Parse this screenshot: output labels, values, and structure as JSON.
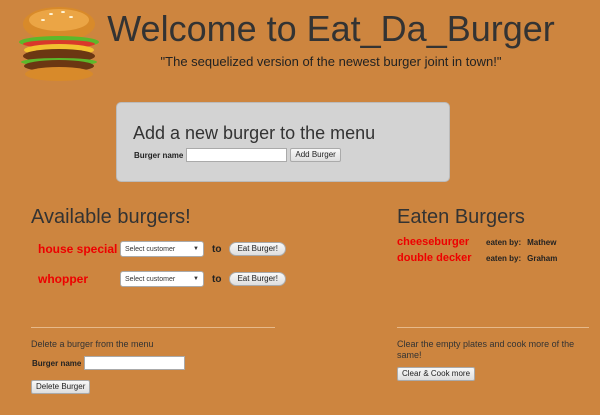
{
  "header": {
    "title": "Welcome to Eat_Da_Burger",
    "tagline": "\"The sequelized version of the newest burger joint in town!\"",
    "logo_icon": "burger-logo-icon"
  },
  "add_panel": {
    "heading": "Add a new burger to the menu",
    "label": "Burger name",
    "input_value": "",
    "button_label": "Add Burger"
  },
  "available": {
    "heading": "Available burgers!",
    "items": [
      {
        "name": "house special",
        "select_value": "Select customer",
        "to_label": "to",
        "button_label": "Eat Burger!"
      },
      {
        "name": "whopper",
        "select_value": "Select customer",
        "to_label": "to",
        "button_label": "Eat Burger!"
      }
    ]
  },
  "eaten": {
    "heading": "Eaten Burgers",
    "items": [
      {
        "name": "cheeseburger",
        "label": "eaten by:",
        "eater": "Mathew"
      },
      {
        "name": "double decker",
        "label": "eaten by:",
        "eater": "Graham"
      }
    ]
  },
  "delete_section": {
    "heading": "Delete a burger from the menu",
    "label": "Burger name",
    "input_value": "",
    "button_label": "Delete Burger"
  },
  "clear_section": {
    "text": "Clear the empty plates and cook more of the same!",
    "button_label": "Clear & Cook more"
  },
  "colors": {
    "background": "#cd853f",
    "panel": "#d3d3d3",
    "burger_name": "#ee0000"
  }
}
